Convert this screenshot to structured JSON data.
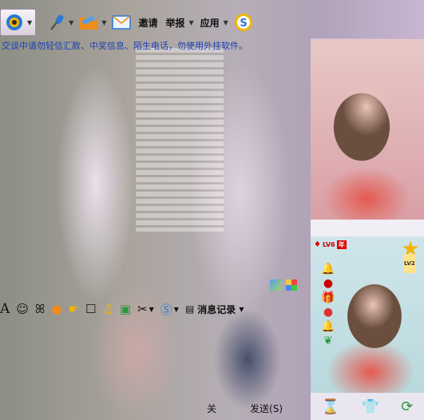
{
  "toolbar": {
    "invite_label": "邀请",
    "report_label": "举报",
    "apps_label": "应用"
  },
  "notice": "交谈中请勿轻信汇款、中奖信息、陌生电话，勿使用外挂软件。",
  "input_tools": {
    "font_glyph": "A",
    "history_label": "消息记录"
  },
  "right_panel": {
    "badge_level_text": "LV6",
    "badge_year_text": "年",
    "star_level_text": "LV2"
  },
  "buttons": {
    "close_label": "关",
    "send_label": "发送(S)"
  },
  "colors": {
    "notice_text": "#1a3fb4",
    "accent_orange": "#f08c1a",
    "accent_blue": "#2a78d4"
  }
}
